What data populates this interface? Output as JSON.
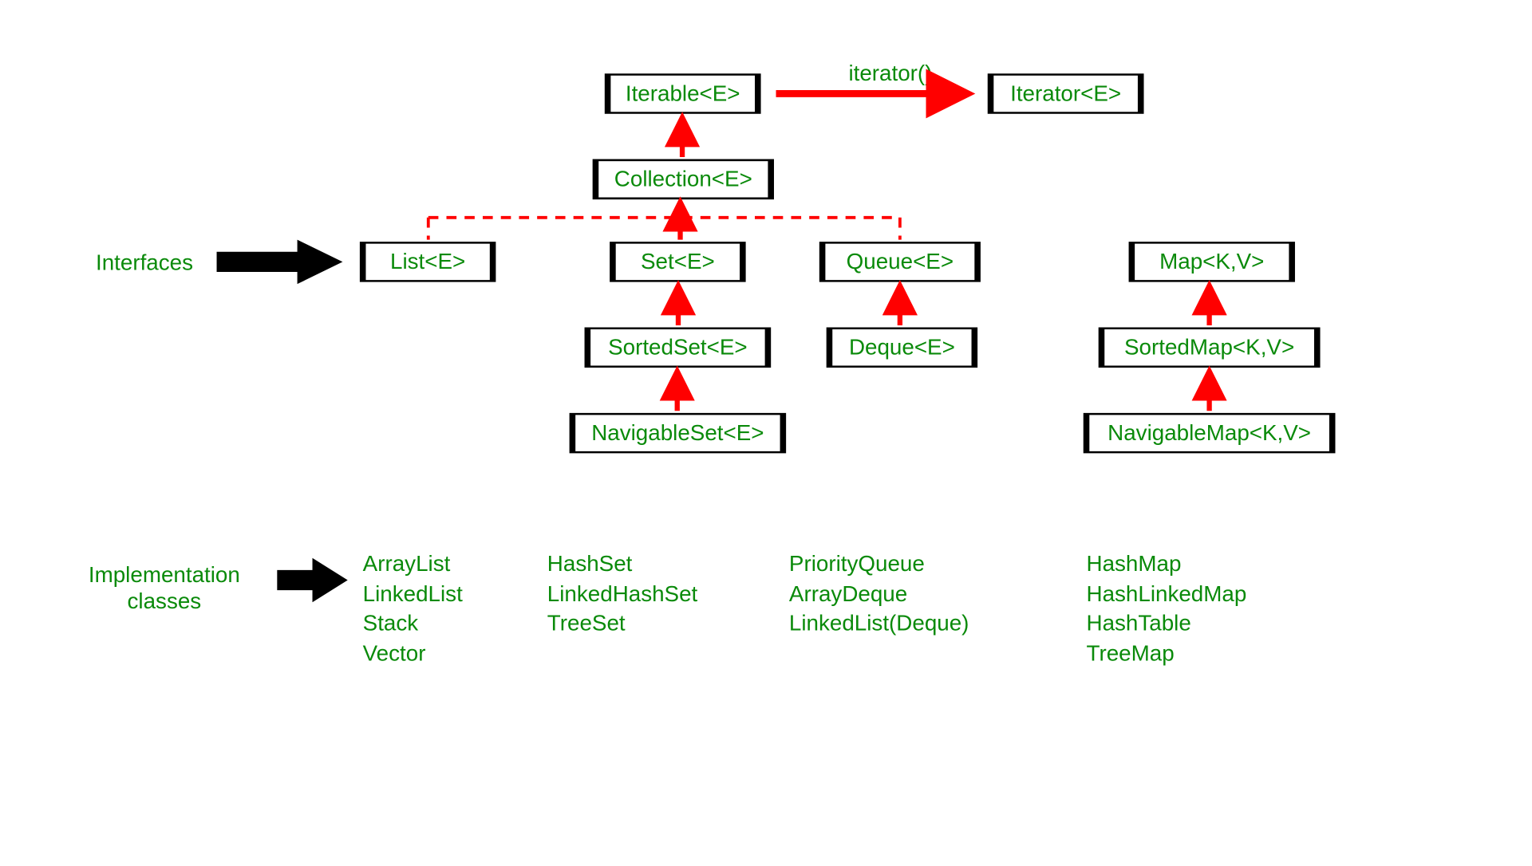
{
  "nodes": {
    "iterable": "Iterable<E>",
    "iterator": "Iterator<E>",
    "collection": "Collection<E>",
    "list": "List<E>",
    "set": "Set<E>",
    "queue": "Queue<E>",
    "sortedset": "SortedSet<E>",
    "navigableset": "NavigableSet<E>",
    "deque": "Deque<E>",
    "map": "Map<K,V>",
    "sortedmap": "SortedMap<K,V>",
    "navigablemap": "NavigableMap<K,V>"
  },
  "labels": {
    "iterator_method": "iterator()",
    "interfaces": "Interfaces",
    "impl_line1": "Implementation",
    "impl_line2": "classes"
  },
  "impl": {
    "list": "ArrayList\nLinkedList\nStack\nVector",
    "set": "HashSet\nLinkedHashSet\nTreeSet",
    "queue": "PriorityQueue\nArrayDeque\nLinkedList(Deque)",
    "map": "HashMap\nHashLinkedMap\nHashTable\nTreeMap"
  }
}
